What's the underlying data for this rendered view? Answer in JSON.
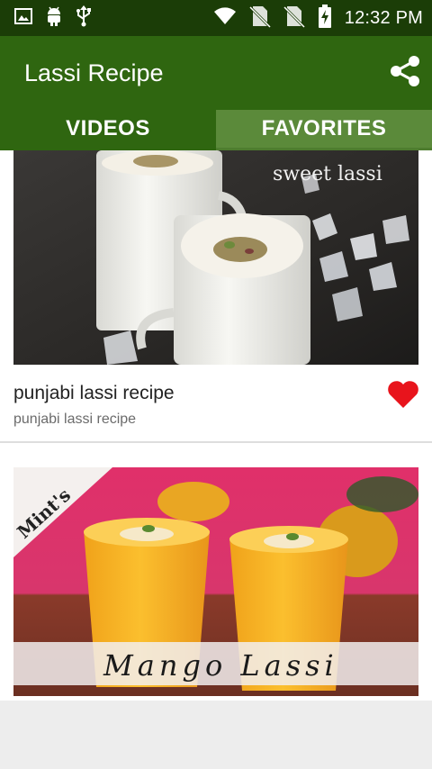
{
  "status_bar": {
    "time": "12:32 PM",
    "icons": [
      "image-icon",
      "android-icon",
      "usb-icon",
      "wifi-icon",
      "no-sim-icon",
      "no-sim-icon",
      "battery-charging-icon"
    ]
  },
  "app_bar": {
    "title": "Lassi Recipe",
    "share_icon": "share-icon"
  },
  "tabs": [
    {
      "label": "VIDEOS",
      "active": true
    },
    {
      "label": "FAVORITES",
      "active": false
    }
  ],
  "videos": [
    {
      "thumbnail_caption": "sweet lassi",
      "title": "punjabi lassi recipe",
      "subtitle": "punjabi lassi recipe",
      "favorite_icon": "heart-icon"
    },
    {
      "thumbnail_badge": "Mint's",
      "thumbnail_caption": "Mango Lassi"
    }
  ],
  "colors": {
    "status_bar": "#1b3d07",
    "app_bar": "#2f6610",
    "tab_inactive": "#5b8a3a",
    "heart": "#e8141c"
  }
}
